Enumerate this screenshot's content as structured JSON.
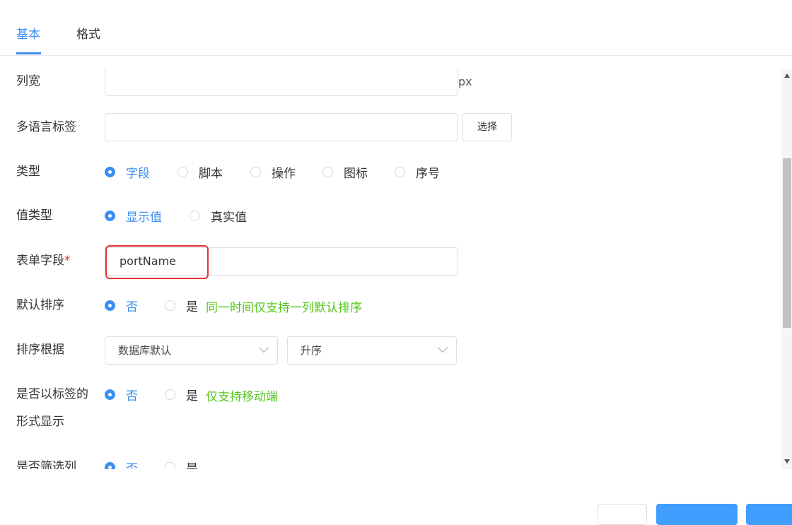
{
  "tabs": [
    {
      "label": "基本",
      "active": true
    },
    {
      "label": "格式",
      "active": false
    }
  ],
  "form": {
    "column_width": {
      "label": "列宽",
      "value": "",
      "suffix": "px"
    },
    "i18n_label": {
      "label": "多语言标签",
      "value": "",
      "button": "选择"
    },
    "type": {
      "label": "类型",
      "options": [
        "字段",
        "脚本",
        "操作",
        "图标",
        "序号"
      ],
      "selected": "字段"
    },
    "value_type": {
      "label": "值类型",
      "options": [
        "显示值",
        "真实值"
      ],
      "selected": "显示值"
    },
    "form_field": {
      "label": "表单字段",
      "required_mark": "*",
      "value": "portName"
    },
    "default_sort": {
      "label": "默认排序",
      "options": [
        "否",
        "是"
      ],
      "selected": "否",
      "hint": "同一时间仅支持一列默认排序"
    },
    "sort_by": {
      "label": "排序根据",
      "field_value": "数据库默认",
      "order_value": "升序"
    },
    "show_as_tag": {
      "label_line1": "是否以标签的",
      "label_line2": "形式显示",
      "options": [
        "否",
        "是"
      ],
      "selected": "否",
      "hint": "仅支持移动端"
    },
    "filter_column": {
      "label": "是否筛选列",
      "options": [
        "否",
        "是"
      ],
      "selected": "否"
    }
  },
  "colors": {
    "accent": "#3c8ef0",
    "hint": "#52c41a",
    "required": "#f5222d",
    "highlight": "#e8322f"
  }
}
